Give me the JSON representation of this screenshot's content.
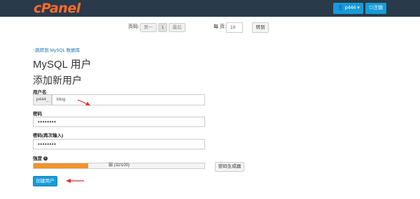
{
  "header": {
    "logo": "cPanel",
    "user_label": "p444",
    "logout_label": "注销"
  },
  "pager": {
    "page_label": "页码:",
    "first": "第一",
    "current": "1",
    "last": "最后",
    "per_page_label": "每 页:",
    "per_page_value": "10",
    "go": "转到"
  },
  "back_link": "跳转到 MySQL 数据库",
  "title": "MySQL 用户",
  "subtitle": "添加新用户",
  "form": {
    "username_label": "用户名",
    "username_prefix": "p444_",
    "username_value": "blog",
    "password_label": "密码",
    "password_value": "••••••••",
    "password2_label": "密码(再次输入)",
    "password2_value": "••••••••",
    "strength_label": "强度",
    "strength_text": "弱 (32/100)",
    "strength_fraction": 0.32,
    "generator_label": "密码生成器",
    "create_label": "创建用户"
  },
  "colors": {
    "topbar": "#293a4a",
    "accent": "#179bd7",
    "logo": "#ff6c2c",
    "strength": "#f0932b",
    "arrow": "#e0312b"
  }
}
